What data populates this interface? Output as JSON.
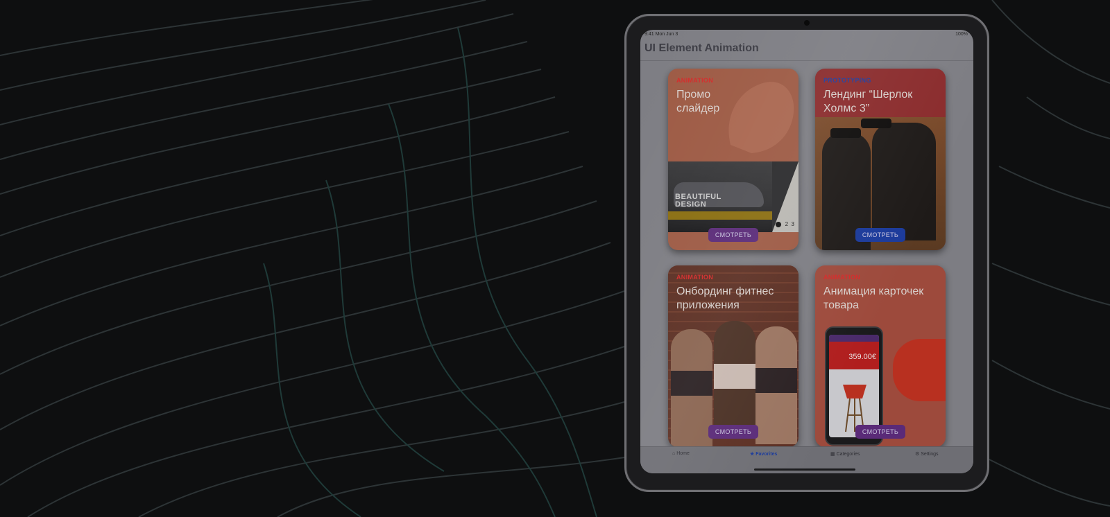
{
  "status_bar": {
    "time": "9:41  Mon Jun 3",
    "battery": "100%"
  },
  "nav": {
    "title": "UI Element Animation"
  },
  "cards": [
    {
      "category": "ANIMATION",
      "category_color": "#d42a2a",
      "title": "Промо слайдер",
      "button": "СМОТРЕТЬ",
      "slide_text": "BEAUTIFUL DESIGN",
      "pager": [
        "2",
        "3"
      ]
    },
    {
      "category": "PROTOTYPING",
      "category_color": "#1e3c9e",
      "title": "Лендинг “Шерлок Холмс 3”",
      "button": "СМОТРЕТЬ"
    },
    {
      "category": "ANIMATION",
      "category_color": "#d42a2a",
      "title": "Онбординг фитнес приложения",
      "button": "СМОТРЕТЬ"
    },
    {
      "category": "ANIMATION",
      "category_color": "#d42a2a",
      "title": "Анимация карточек товара",
      "button": "СМОТРЕТЬ",
      "phone_price": "359.00€"
    }
  ],
  "tabs": [
    {
      "label": "Home",
      "icon": "home-icon",
      "active": false
    },
    {
      "label": "Favorites",
      "icon": "star-icon",
      "active": true
    },
    {
      "label": "Categories",
      "icon": "grid-icon",
      "active": false
    },
    {
      "label": "Settings",
      "icon": "gear-icon",
      "active": false
    }
  ],
  "colors": {
    "background": "#0e0f10",
    "accent_purple": "#5a2a78",
    "accent_blue": "#1b3a9a"
  }
}
